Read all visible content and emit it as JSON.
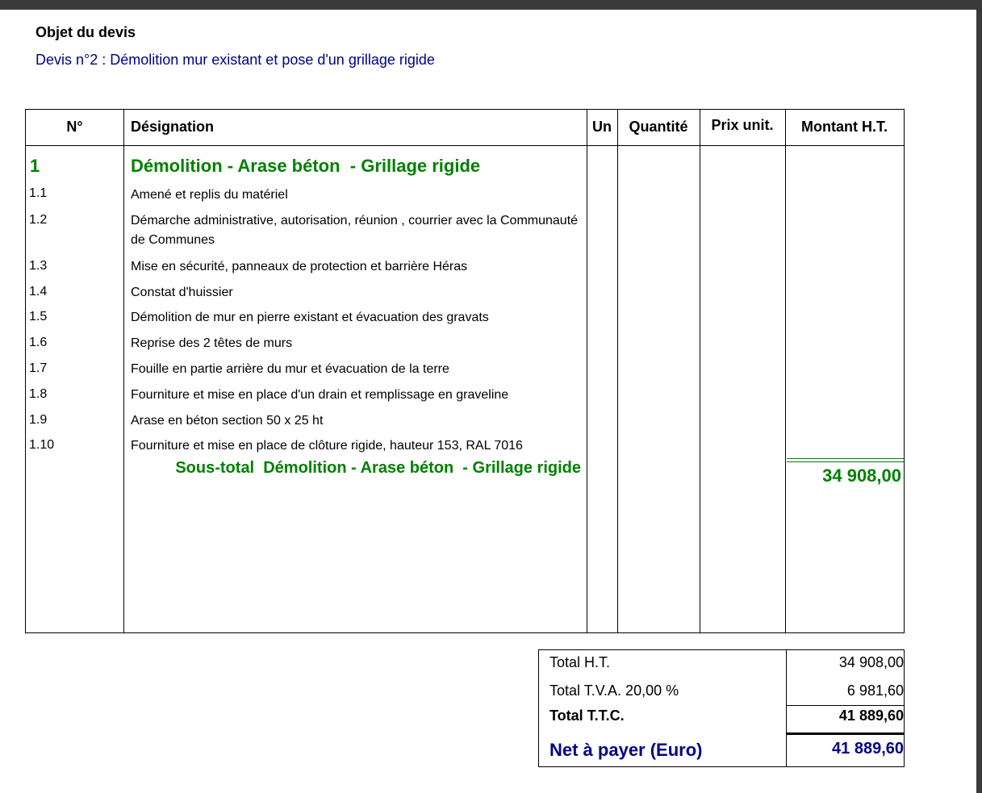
{
  "header": {
    "objet_title": "Objet du devis",
    "devis_line": "Devis n°2 : Démolition mur existant et pose d'un grillage rigide"
  },
  "table": {
    "columns": [
      "N°",
      "Désignation",
      "Un",
      "Quantité",
      "Prix unit.",
      "Montant H.T."
    ],
    "section": {
      "number": "1",
      "title": "Démolition - Arase béton  - Grillage rigide"
    },
    "rows": [
      {
        "num": "1.1",
        "desc": "Amené et replis du matériel"
      },
      {
        "num": "1.2",
        "desc": "Démarche administrative, autorisation, réunion , courrier avec la Communauté de Communes"
      },
      {
        "num": "1.3",
        "desc": "Mise en sécurité, panneaux de protection et barrière Héras"
      },
      {
        "num": "1.4",
        "desc": "Constat d'huissier"
      },
      {
        "num": "1.5",
        "desc": "Démolition de mur en pierre existant et évacuation des gravats"
      },
      {
        "num": "1.6",
        "desc": "Reprise des 2 têtes de murs"
      },
      {
        "num": "1.7",
        "desc": "Fouille en partie arrière du mur et évacuation de la terre"
      },
      {
        "num": "1.8",
        "desc": "Fourniture et mise en place d'un drain et remplissage en graveline"
      },
      {
        "num": "1.9",
        "desc": "Arase en béton section 50 x 25 ht"
      },
      {
        "num": "1.10",
        "desc": "Fourniture et mise en place de clôture rigide, hauteur 153, RAL 7016"
      }
    ],
    "subtotal": {
      "label": "Sous-total  Démolition - Arase béton  - Grillage rigide",
      "amount": "34 908,00"
    }
  },
  "totals": {
    "total_ht_label": "Total H.T.",
    "total_ht_value": "34 908,00",
    "tva_label": "Total T.V.A. 20,00 %",
    "tva_value": "6 981,60",
    "ttc_label": "Total T.T.C.",
    "ttc_value": "41 889,60",
    "net_label": "Net à payer (Euro)",
    "net_value": "41 889,60"
  },
  "colors": {
    "section_green": "#008000",
    "heading_blue": "#00008b",
    "frame_dark": "#3a3a3a"
  }
}
